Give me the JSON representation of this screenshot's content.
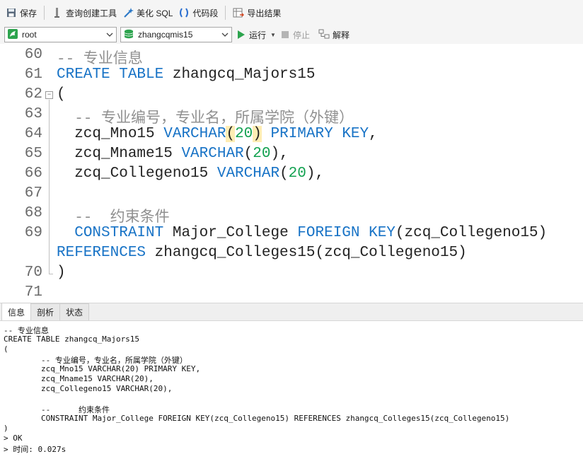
{
  "toolbar": {
    "save": "保存",
    "query_builder": "查询创建工具",
    "beautify_sql": "美化 SQL",
    "code_snippet": "代码段",
    "export_results": "导出结果"
  },
  "connection": {
    "user": "root",
    "database": "zhangcqmis15",
    "run": "运行",
    "stop": "停止",
    "explain": "解释"
  },
  "editor": {
    "line_numbers": [
      "60",
      "61",
      "62",
      "63",
      "64",
      "65",
      "66",
      "67",
      "68",
      "69",
      "70",
      "71"
    ],
    "lines": [
      [
        {
          "t": "-- 专业信息",
          "c": "cmt"
        }
      ],
      [
        {
          "t": "CREATE TABLE",
          "c": "kw"
        },
        {
          "t": " zhangcq_Majors15",
          "c": ""
        }
      ],
      [
        {
          "t": "(",
          "c": ""
        }
      ],
      [
        {
          "t": "  -- 专业编号，专业名，所属学院（外键）",
          "c": "cmt"
        }
      ],
      [
        {
          "t": "  zcq_Mno15 ",
          "c": ""
        },
        {
          "t": "VARCHAR",
          "c": "kw"
        },
        {
          "t": "(",
          "c": "hl"
        },
        {
          "t": "20",
          "c": "num"
        },
        {
          "t": ")",
          "c": "hl"
        },
        {
          "t": " ",
          "c": ""
        },
        {
          "t": "PRIMARY KEY",
          "c": "kw"
        },
        {
          "t": ",",
          "c": ""
        }
      ],
      [
        {
          "t": "  zcq_Mname15 ",
          "c": ""
        },
        {
          "t": "VARCHAR",
          "c": "kw"
        },
        {
          "t": "(",
          "c": ""
        },
        {
          "t": "20",
          "c": "num"
        },
        {
          "t": "),",
          "c": ""
        }
      ],
      [
        {
          "t": "  zcq_Collegeno15 ",
          "c": ""
        },
        {
          "t": "VARCHAR",
          "c": "kw"
        },
        {
          "t": "(",
          "c": ""
        },
        {
          "t": "20",
          "c": "num"
        },
        {
          "t": "),",
          "c": ""
        }
      ],
      [],
      [
        {
          "t": "  --  约束条件",
          "c": "cmt"
        }
      ],
      [
        {
          "t": "  ",
          "c": ""
        },
        {
          "t": "CONSTRAINT",
          "c": "kw"
        },
        {
          "t": " Major_College ",
          "c": ""
        },
        {
          "t": "FOREIGN KEY",
          "c": "kw"
        },
        {
          "t": "(zcq_Collegeno15)",
          "c": ""
        }
      ],
      [
        {
          "t": "REFERENCES",
          "c": "kw"
        },
        {
          "t": " zhangcq_Colleges15(zcq_Collegeno15)",
          "c": ""
        }
      ],
      [
        {
          "t": ")",
          "c": ""
        }
      ],
      []
    ]
  },
  "tabs": [
    "信息",
    "剖析",
    "状态"
  ],
  "output": [
    "-- 专业信息",
    "CREATE TABLE zhangcq_Majors15",
    "(",
    "        -- 专业编号，专业名，所属学院（外键）",
    "        zcq_Mno15 VARCHAR(20) PRIMARY KEY,",
    "        zcq_Mname15 VARCHAR(20),",
    "        zcq_Collegeno15 VARCHAR(20),",
    "",
    "        --      约束条件",
    "        CONSTRAINT Major_College FOREIGN KEY(zcq_Collegeno15) REFERENCES zhangcq_Colleges15(zcq_Collegeno15)",
    ")",
    "> OK",
    "> 时间: 0.027s"
  ],
  "colors": {
    "keyword": "#1873c6",
    "number": "#12a150",
    "comment": "#909090",
    "bracket_highlight": "#ffedb3"
  }
}
